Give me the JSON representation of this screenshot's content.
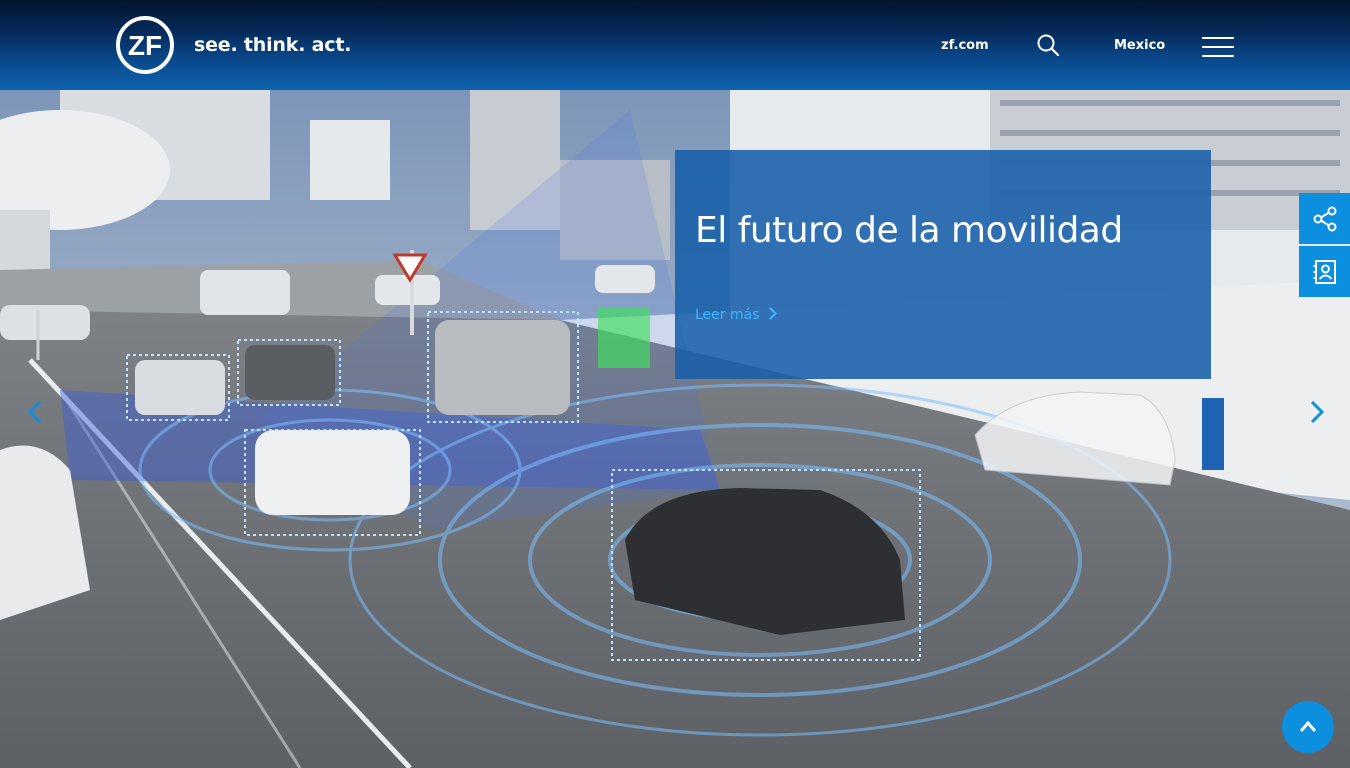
{
  "header": {
    "logo_text": "ZF",
    "tagline": "see. think. act.",
    "nav_zf": "zf.com",
    "region": "Mexico",
    "search_icon": "search-icon",
    "menu_icon": "hamburger-menu-icon"
  },
  "hero": {
    "title": "El futuro de la movilidad",
    "link_label": "Leer más",
    "prev_icon": "chevron-left-icon",
    "next_icon": "chevron-right-icon"
  },
  "side_tabs": {
    "share_icon": "share-icon",
    "contact_icon": "contact-book-icon"
  },
  "to_top_icon": "chevron-up-icon",
  "colors": {
    "header_dark": "#04142e",
    "header_blue": "#0f63b0",
    "accent": "#0d8fe0",
    "link": "#3fb6ff",
    "teaser_bg": "#175faa"
  }
}
